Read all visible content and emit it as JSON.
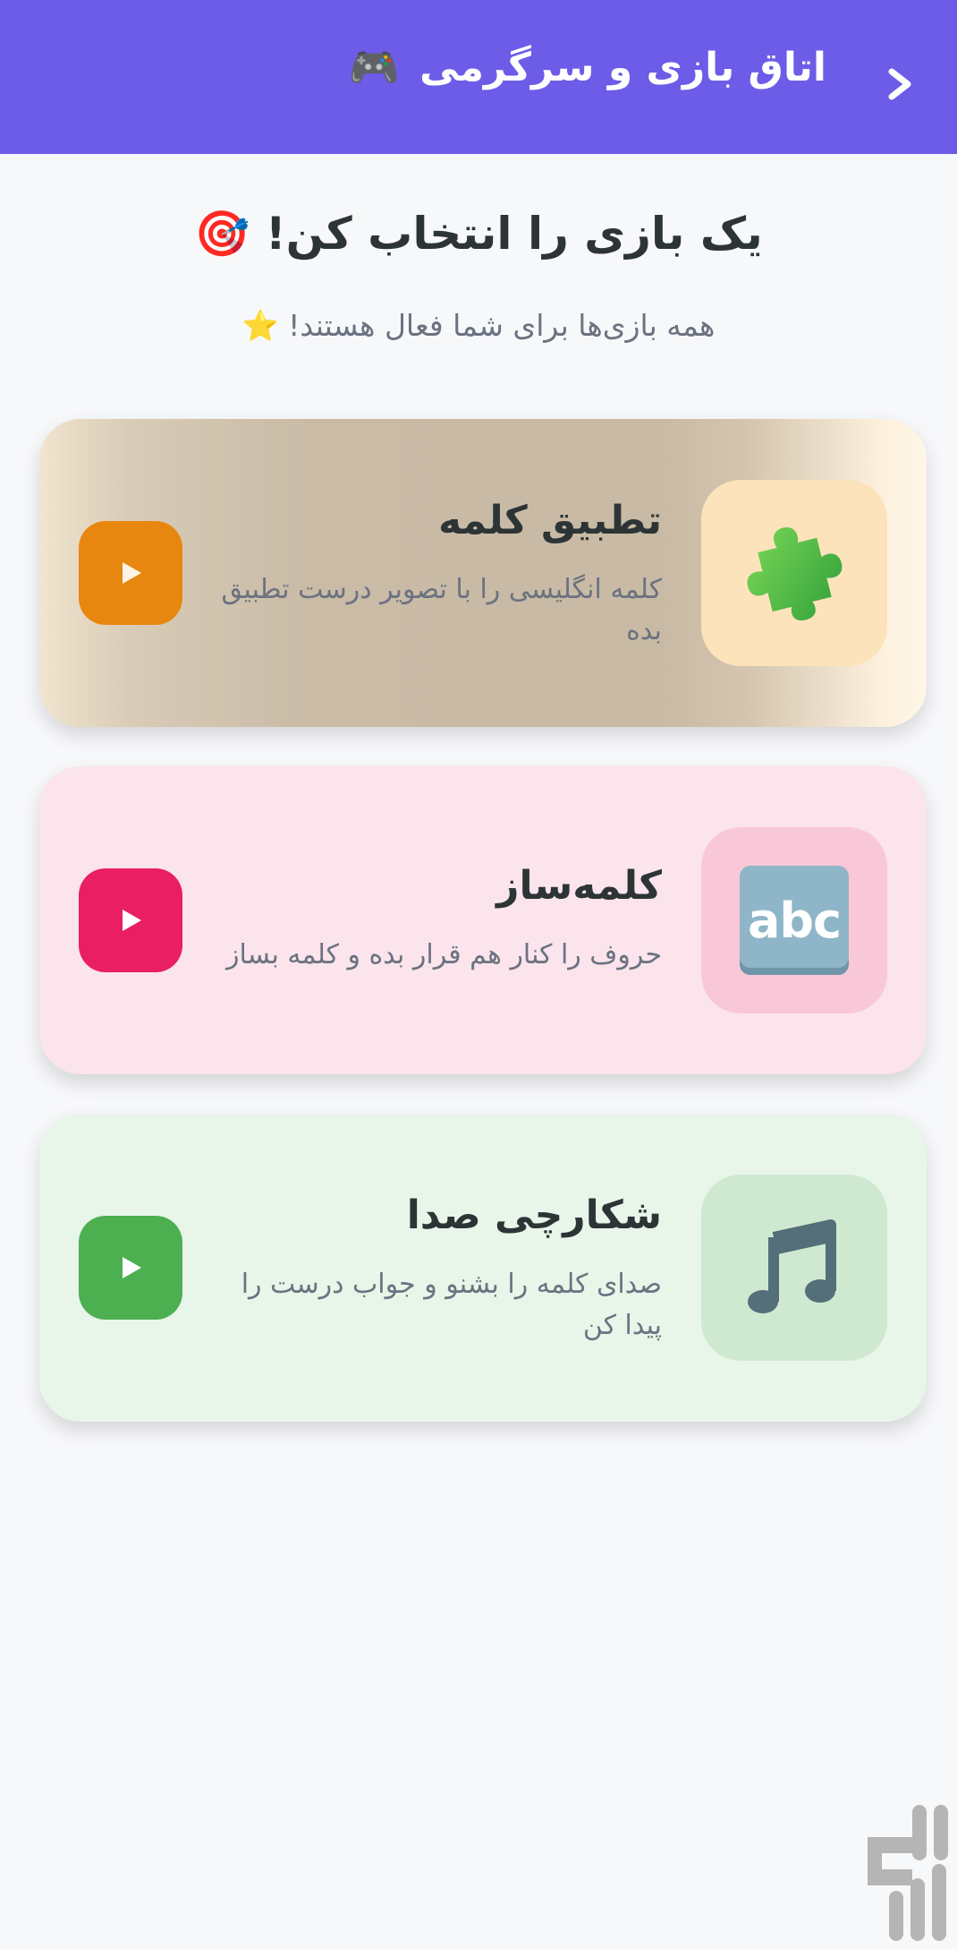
{
  "header": {
    "title": "اتاق بازی و سرگرمی",
    "title_icon": "🎮",
    "back_icon": "chevron-back-icon",
    "background": "#6c5ce7"
  },
  "intro": {
    "heading": "یک بازی را انتخاب کن!",
    "heading_icon": "🎯",
    "subheading": "همه بازی‌ها برای شما فعال هستند!",
    "subheading_icon": "⭐"
  },
  "games": [
    {
      "title": "تطبیق کلمه",
      "description": "کلمه انگلیسی را با تصویر درست تطبیق بده",
      "icon": "puzzle-piece-icon",
      "play_color": "#e8870f"
    },
    {
      "title": "کلمه‌ساز",
      "description": "حروف را کنار هم قرار بده و کلمه بساز",
      "icon": "abc-letters-icon",
      "icon_text": "abc",
      "play_color": "#e91e63"
    },
    {
      "title": "شکارچی صدا",
      "description": "صدای کلمه را بشنو و جواب درست را پیدا کن",
      "icon": "music-note-icon",
      "play_color": "#4caf50"
    }
  ],
  "watermark_icon": "bazaar-logo-icon"
}
